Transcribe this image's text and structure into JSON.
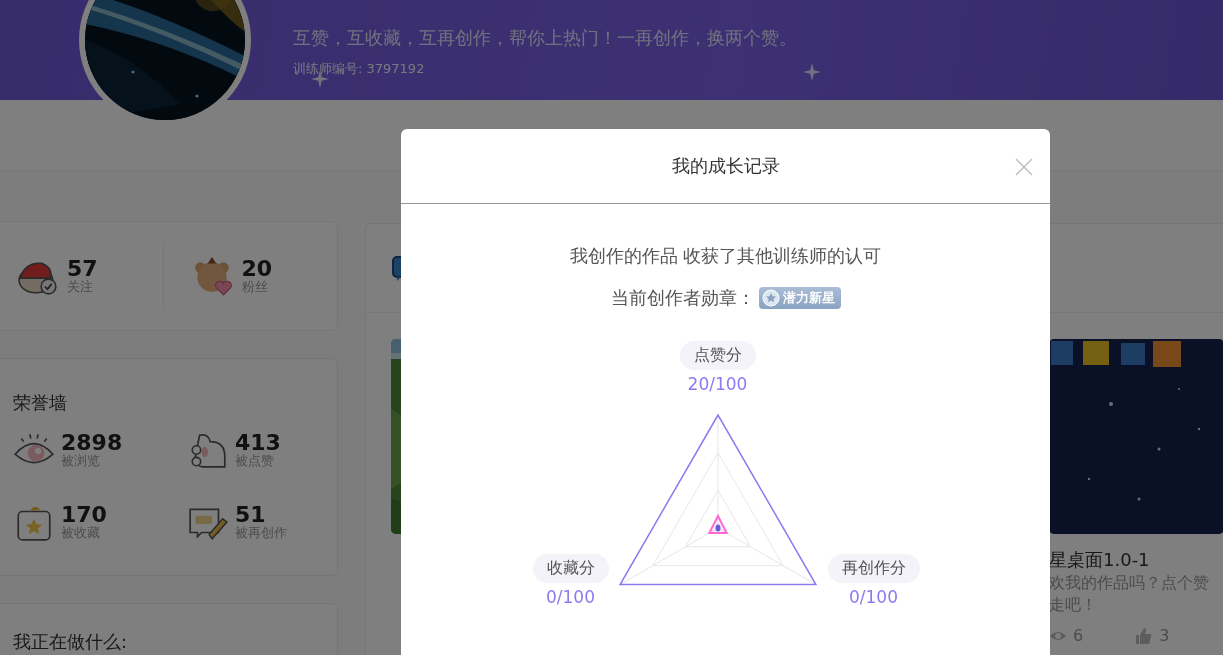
{
  "header": {
    "motto": "互赞，互收藏，互再创作，帮你上热门！一再创作，换两个赞。",
    "trainer_id": "训练师编号: 3797192"
  },
  "social": [
    {
      "kind": "follow",
      "count": "57",
      "label": "关注"
    },
    {
      "kind": "fans",
      "count": "20",
      "label": "粉丝"
    }
  ],
  "honor_wall": {
    "title": "荣誉墙",
    "stats": [
      {
        "kind": "views",
        "count": "2898",
        "label": "被浏览"
      },
      {
        "kind": "likes",
        "count": "413",
        "label": "被点赞"
      },
      {
        "kind": "favorites",
        "count": "170",
        "label": "被收藏"
      },
      {
        "kind": "remixes",
        "count": "51",
        "label": "被再创作"
      }
    ]
  },
  "status": {
    "title": "我正在做什么:"
  },
  "works": [
    {
      "kind": "picture"
    },
    {
      "title": "星桌面1.0-1",
      "description": [
        "欢我的作品吗？点个赞",
        "走吧！"
      ],
      "views": "6",
      "likes": "3"
    }
  ],
  "modal": {
    "title": "我的成长记录",
    "message": "我创作的作品 收获了其他训练师的认可",
    "badge_label": "当前创作者勋章：",
    "badge": "潜力新星",
    "axes": [
      {
        "label": "点赞分",
        "score": "20/100"
      },
      {
        "label": "收藏分",
        "score": "0/100"
      },
      {
        "label": "再创作分",
        "score": "0/100"
      }
    ]
  }
}
